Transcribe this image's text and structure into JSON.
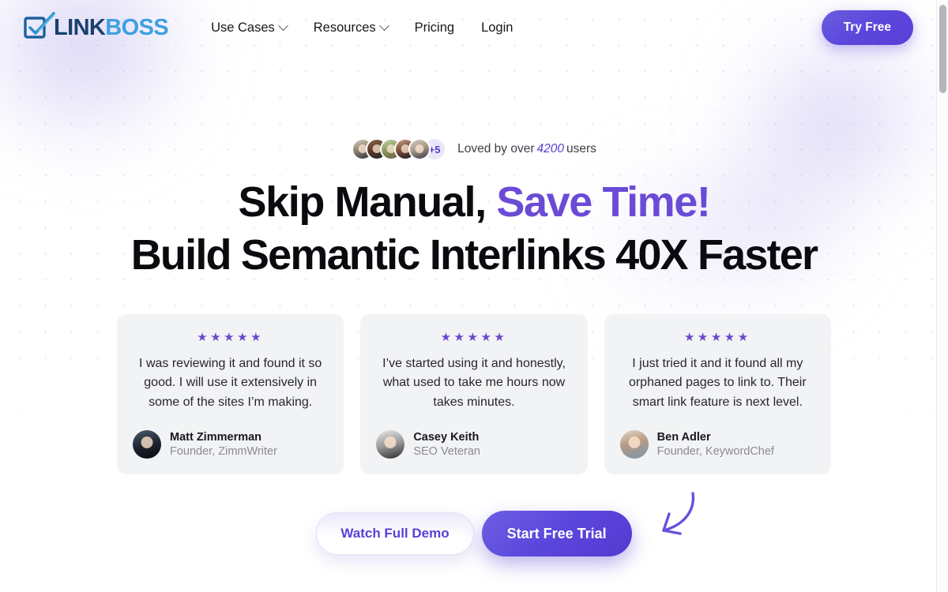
{
  "header": {
    "logo": {
      "part1": "LINK",
      "part2": "BOSS",
      "icon": "checkbox-pencil-icon"
    },
    "nav": [
      {
        "label": "Use Cases",
        "has_dropdown": true
      },
      {
        "label": "Resources",
        "has_dropdown": true
      },
      {
        "label": "Pricing",
        "has_dropdown": false
      },
      {
        "label": "Login",
        "has_dropdown": false
      }
    ],
    "cta_label": "Try Free"
  },
  "hero": {
    "social_proof": {
      "prefix": "Loved by over",
      "count": "4200",
      "suffix": "users",
      "avatar_overflow": "+5",
      "avatar_count": 5
    },
    "headline_line1_plain": "Skip Manual, ",
    "headline_line1_accent": "Save Time!",
    "headline_line2": "Build Semantic Interlinks 40X Faster"
  },
  "testimonials": [
    {
      "stars": "★★★★★",
      "quote": "I was reviewing it and found it so good. I will use it extensively in some of the sites I’m making.",
      "name": "Matt Zimmerman",
      "role": "Founder, ZimmWriter"
    },
    {
      "stars": "★★★★★",
      "quote": "I’ve started using it and honestly, what used to take me hours now takes minutes.",
      "name": "Casey Keith",
      "role": "SEO Veteran"
    },
    {
      "stars": "★★★★★",
      "quote": "I just tried it and it found all my orphaned pages to link to. Their smart link feature is next level.",
      "name": "Ben Adler",
      "role": "Founder, KeywordChef"
    }
  ],
  "cta": {
    "secondary_label": "Watch Full Demo",
    "primary_label": "Start Free Trial",
    "arrow": "curved-arrow-icon"
  },
  "colors": {
    "accent_purple": "#6b4bd6",
    "button_purple": "#5b46dc",
    "star_purple": "#6b47cc",
    "logo_dark": "#17416b",
    "logo_light": "#3ea0e0",
    "card_bg": "#f1f3f5"
  }
}
